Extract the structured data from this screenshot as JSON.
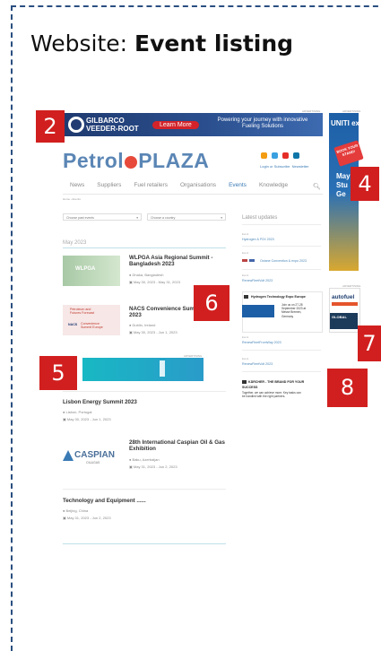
{
  "header": {
    "prefix": "Website: ",
    "title": "Event listing"
  },
  "ads": {
    "advertising_label": "ADVERTISING",
    "top_brand_line1": "GILBARCO",
    "top_brand_line2": "VEEDER-ROOT",
    "top_cta": "Learn More",
    "top_tagline_line1": "Powering your journey with innovative",
    "top_tagline_line2": "Fueling Solutions",
    "side_brand": "UNITI expo",
    "side_cta_line1": "BOOK YOUR",
    "side_cta_line2": "STAND!",
    "side_text_line1": "May",
    "side_text_line2": "Stu",
    "side_text_line3": "Ge",
    "side2_brand": "autofuel",
    "side2_sub": "GLOBAL"
  },
  "site": {
    "logo_a": "Petrol",
    "logo_b": "PLAZA",
    "login": "Login or Subscribe",
    "newsletter": "Newsletter",
    "nav": [
      "News",
      "Suppliers",
      "Fuel retailers",
      "Organisations",
      "Events",
      "Knowledge"
    ],
    "nav_active": "Events",
    "breadcrumb": "Home  ›  Events",
    "filter_past": "Choose past events",
    "filter_country": "Choose a country",
    "month": "May 2023"
  },
  "events": [
    {
      "title_line1": "WLPGA Asia Regional Summit -",
      "title_line2": "Bangladesh 2023",
      "location": "Dhaka, Bangladesh",
      "dates": "May 30, 2023 - May 31, 2023",
      "thumb_text": "WLPGA"
    },
    {
      "title_line1": "NACS Convenience Sum",
      "title_line2": "2023",
      "location": "Dublin, Ireland",
      "dates": "May 30, 2023 - Jun 1, 2023",
      "thumb_text_line1": "Petroleum and",
      "thumb_text_line2": "Futures Forecast",
      "thumb_text_line3": "NACS",
      "thumb_text_line4": "Convenience",
      "thumb_text_line5": "Summit Europe"
    },
    {
      "title_line1": "Lisbon Energy Summit 2023",
      "title_line2": "",
      "location": "Lisbon, Portugal",
      "dates": "May 30, 2023 - Jun 1, 2023"
    },
    {
      "title_line1": "28th International Caspian Oil & Gas",
      "title_line2": "Exhibition",
      "location": "Baku, Azerbaijan",
      "dates": "May 31, 2023 - Jun 2, 2023",
      "thumb_text": "CASPIAN",
      "thumb_sub": "OIL&GAS"
    },
    {
      "title_line1": "Technology and Equipment ......",
      "title_line2": "",
      "location": "Beijing, China",
      "dates": "May 31, 2023 - Jun 2, 2023"
    }
  ],
  "sidebar": {
    "heading": "Latest updates",
    "items": [
      {
        "label": "Event",
        "text": "Hydrogen & P2X 2023"
      },
      {
        "label": "Event",
        "text": "Octane Convention & expo 2023"
      },
      {
        "label": "Event",
        "text": "RenewFleetVolt 2023"
      },
      {
        "label": "Event",
        "text": "RenewFleetFromWay 2023"
      },
      {
        "label": "Event",
        "text": "RenewFleetVolt 2023"
      }
    ],
    "card1_title": "Hydrogen Technology Expo Europe",
    "card1_body_line1": "Join us on 27-28",
    "card1_body_line2": "September 2023 at",
    "card1_body_line3": "Messe Bremen,",
    "card1_body_line4": "Germany",
    "card2_title": "KÄRCHER - THE BRAND FOR YOUR",
    "card2_title2": "SUCCESS",
    "card2_body_line1": "Together, we can achieve more. Key tasks can",
    "card2_body_line2": "be handled with the right partners."
  },
  "badges": [
    "2",
    "4",
    "5",
    "6",
    "7",
    "8"
  ],
  "colors": {
    "badge": "#d11f1f",
    "frame": "#2a4f80",
    "brand_blue": "#5b86b5",
    "accent_red": "#e74a3b"
  }
}
